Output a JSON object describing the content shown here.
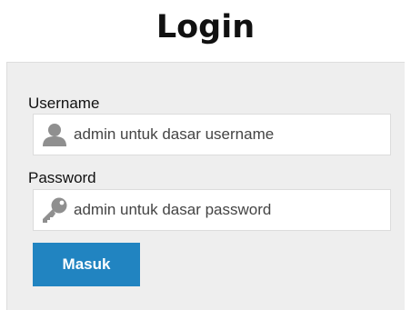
{
  "page": {
    "title": "Login"
  },
  "form": {
    "username_label": "Username",
    "username_placeholder": "admin untuk dasar username",
    "username_icon": "user-icon",
    "password_label": "Password",
    "password_placeholder": "admin untuk dasar password",
    "password_icon": "key-icon",
    "submit_label": "Masuk"
  },
  "colors": {
    "button": "#2184c1",
    "panel": "#eeeeee",
    "icon": "#8f8f8f"
  }
}
